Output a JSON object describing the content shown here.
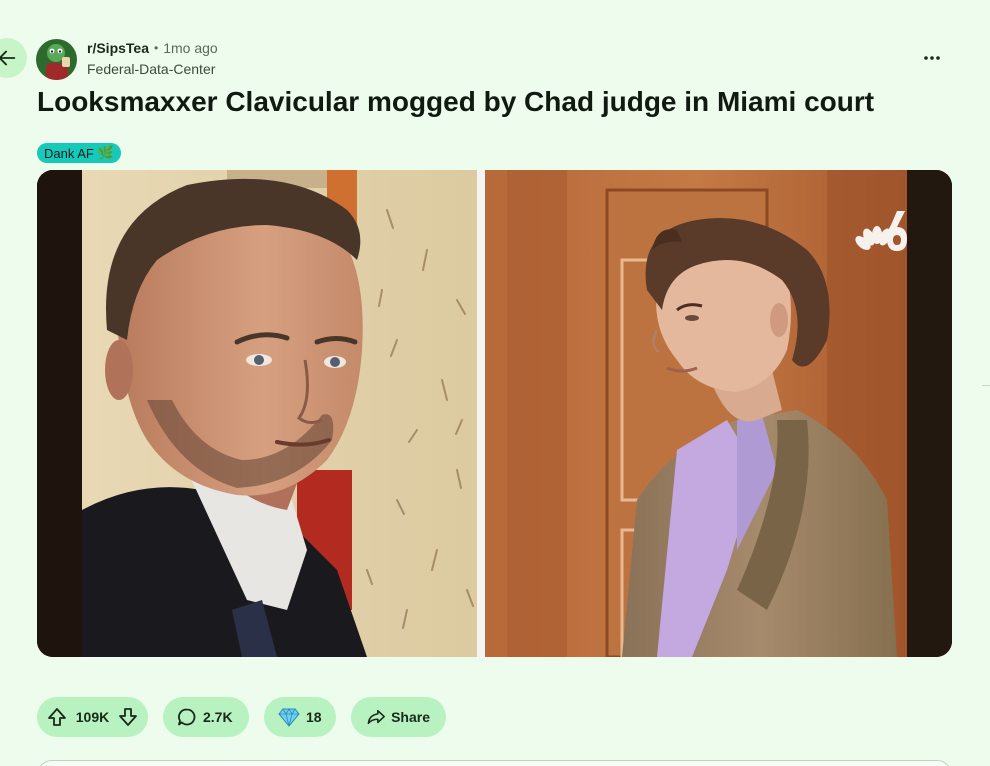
{
  "post": {
    "subreddit": "r/SipsTea",
    "separator": "•",
    "time_ago": "1mo ago",
    "author": "Federal-Data-Center",
    "title": "Looksmaxxer Clavicular mogged by Chad judge in Miami court",
    "flair": {
      "text": "Dank AF",
      "emoji": "🌿",
      "color": "#17c9b9"
    },
    "media": {
      "left_image": "judge-portrait",
      "right_image": "defendant-in-courtroom",
      "watermark_icon": "nbc6-logo-icon"
    }
  },
  "actions": {
    "upvotes": "109K",
    "comments": "2.7K",
    "awards": "18",
    "share_label": "Share"
  },
  "colors": {
    "background": "#eefcee",
    "pill": "#b8f2c0",
    "back_button": "#c8f5c8",
    "flair": "#17c9b9"
  },
  "icons": {
    "back": "arrow-left-icon",
    "more": "more-horizontal-icon",
    "upvote": "arrow-up-icon",
    "downvote": "arrow-down-icon",
    "comment": "comment-bubble-icon",
    "award": "diamond-icon",
    "share": "share-arrow-icon"
  }
}
